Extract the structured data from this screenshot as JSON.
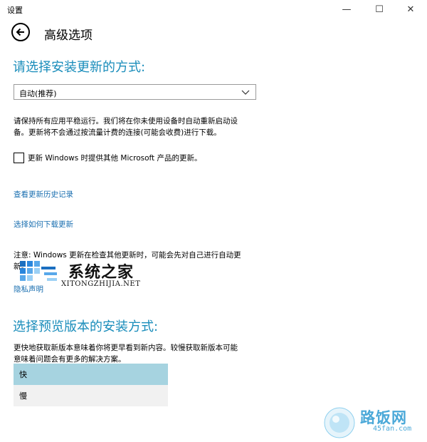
{
  "window": {
    "title": "设置",
    "minimize_glyph": "—",
    "maximize_glyph": "☐",
    "close_glyph": "✕"
  },
  "header": {
    "title": "高级选项"
  },
  "install_method": {
    "heading": "请选择安装更新的方式:",
    "dropdown_value": "自动(推荐)",
    "description_line1": "请保持所有应用平稳运行。我们将在你未使用设备时自动重新启动设",
    "description_line2": "备。更新将不会通过按流量计费的连接(可能会收费)进行下载。",
    "checkbox_label": "更新 Windows 时提供其他 Microsoft 产品的更新。"
  },
  "links": {
    "history": "查看更新历史记录",
    "delivery": "选择如何下载更新",
    "privacy": "隐私声明"
  },
  "note": {
    "line1": "注意: Windows 更新在检查其他更新时，可能会先对自己进行自动更",
    "line2": "新。"
  },
  "preview": {
    "heading": "选择预览版本的安装方式:",
    "description_line1": "更快地获取新版本意味着你将更早看到新内容。较慢获取新版本可能",
    "description_line2": "意味着问题会有更多的解决方案。",
    "options": [
      {
        "label": "快"
      },
      {
        "label": "慢"
      }
    ]
  },
  "watermarks": {
    "site1_name": "系统之家",
    "site1_domain": "XITONGZHIJIA.NET",
    "site2_name": "路饭网",
    "site2_domain": "45fan.com"
  },
  "colors": {
    "accent": "#1a8dbb",
    "link": "#1a6fb0",
    "selected_option": "#a6d3e0",
    "unselected_option": "#f1f1f1"
  }
}
